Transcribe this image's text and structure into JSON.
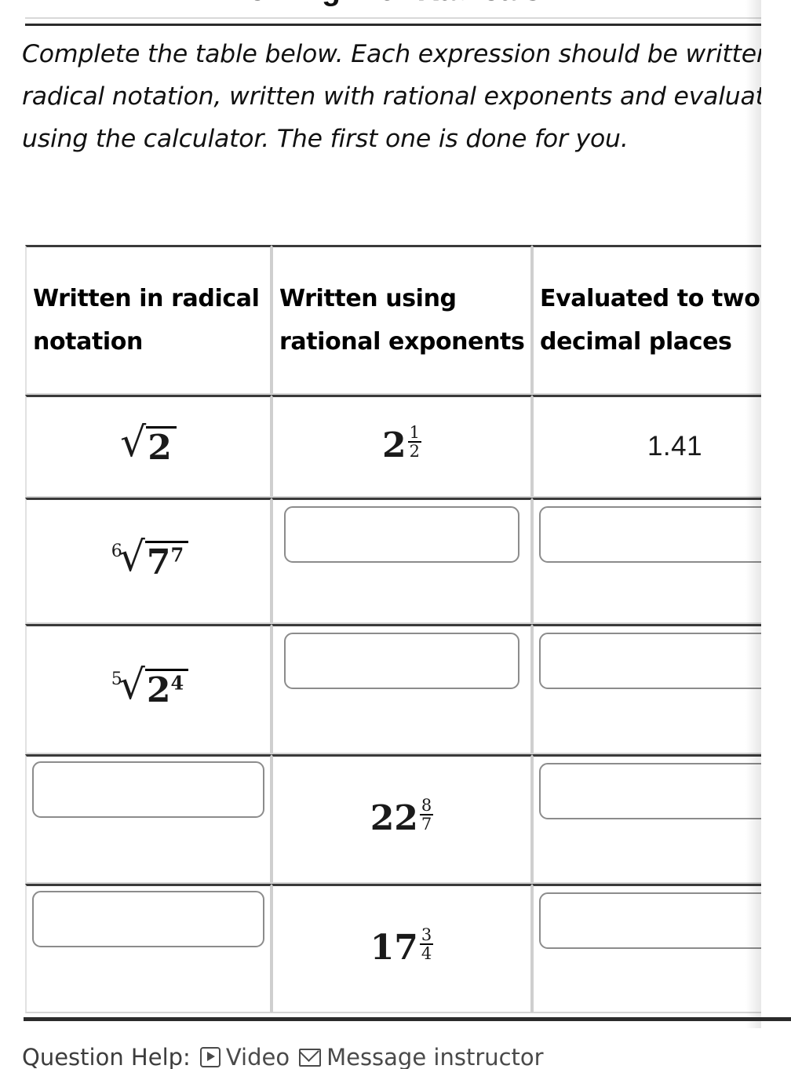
{
  "title": "Working with Radicals",
  "instructions": "Complete the table below. Each expression should be written in radical notation, written with rational exponents and evaluated using the calculator. The first one is done for you.",
  "table": {
    "headers": [
      "Written in radical notation",
      "Written using rational exponents",
      "Evaluated to two decimal places"
    ],
    "rows": [
      {
        "radical": {
          "type": "radical",
          "index": "",
          "radicand": "2",
          "power": ""
        },
        "exponent": {
          "type": "power",
          "base": "2",
          "num": "1",
          "den": "2"
        },
        "evaluated": {
          "type": "value",
          "text": "1.41"
        }
      },
      {
        "radical": {
          "type": "radical",
          "index": "6",
          "radicand": "7",
          "power": "7"
        },
        "exponent": {
          "type": "input",
          "value": ""
        },
        "evaluated": {
          "type": "input",
          "value": ""
        }
      },
      {
        "radical": {
          "type": "radical",
          "index": "5",
          "radicand": "2",
          "power": "4"
        },
        "exponent": {
          "type": "input",
          "value": ""
        },
        "evaluated": {
          "type": "input",
          "value": ""
        }
      },
      {
        "radical": {
          "type": "input",
          "value": ""
        },
        "exponent": {
          "type": "power",
          "base": "22",
          "num": "8",
          "den": "7"
        },
        "evaluated": {
          "type": "input",
          "value": ""
        }
      },
      {
        "radical": {
          "type": "input",
          "value": ""
        },
        "exponent": {
          "type": "power",
          "base": "17",
          "num": "3",
          "den": "4"
        },
        "evaluated": {
          "type": "input",
          "value": ""
        }
      }
    ]
  },
  "question_help": {
    "label": "Question Help:",
    "video_label": "Video",
    "video_icon": "play-button-icon",
    "message_label": "Message instructor",
    "message_icon": "envelope-icon"
  }
}
